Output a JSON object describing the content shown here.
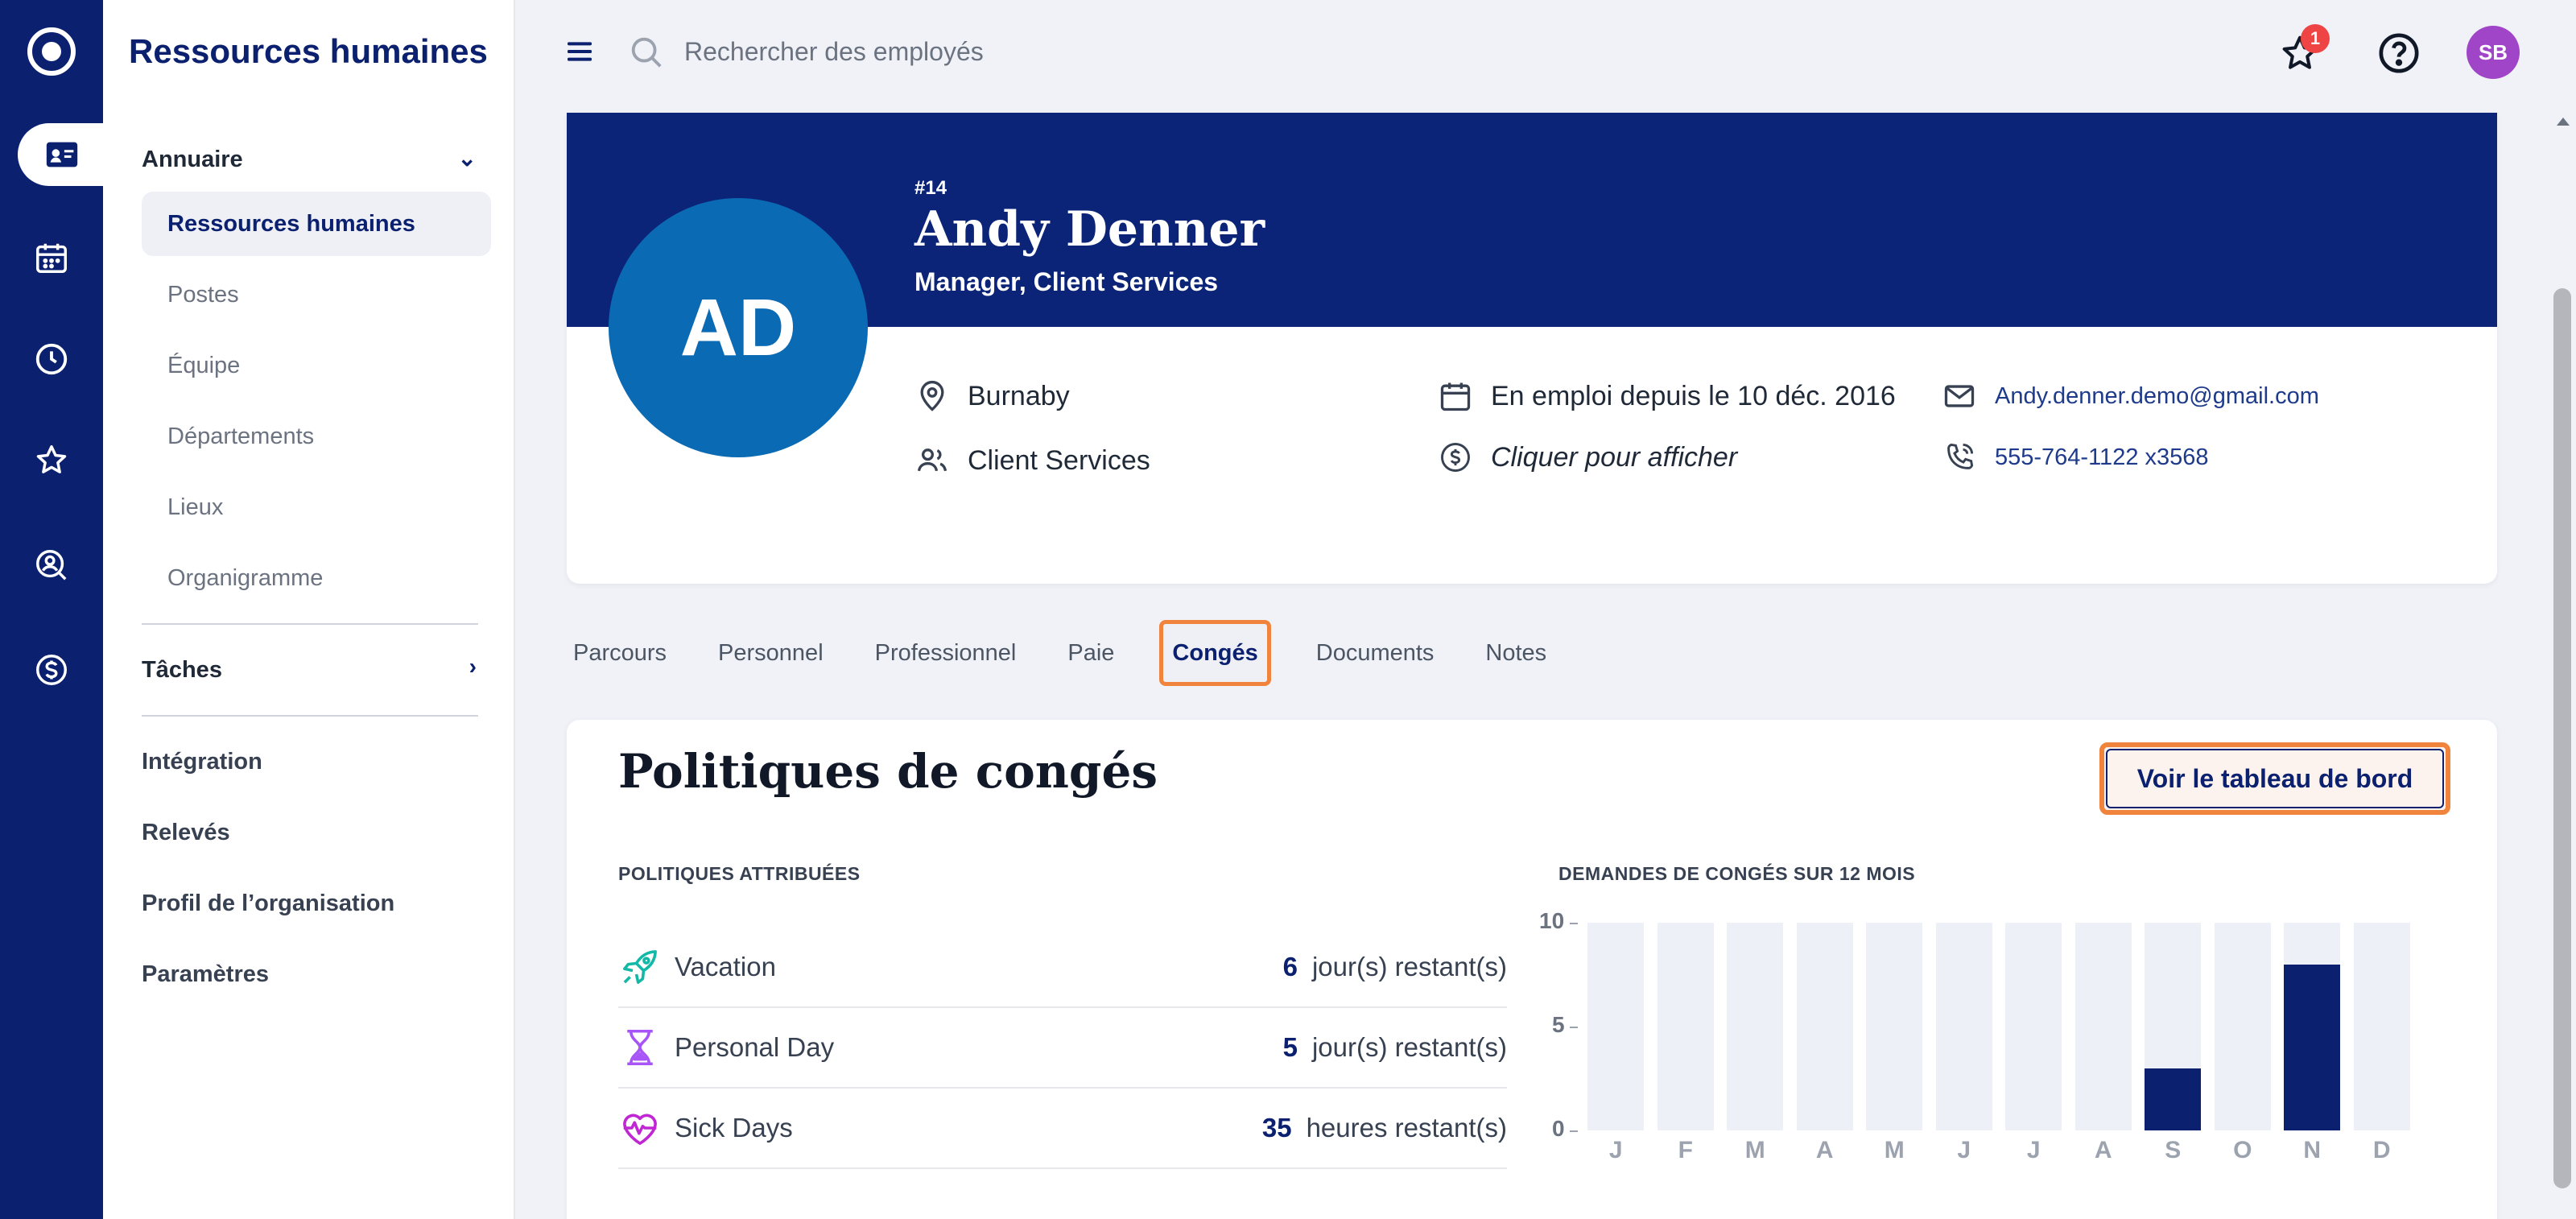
{
  "app": {
    "title": "Ressources humaines"
  },
  "search": {
    "placeholder": "Rechercher des employés"
  },
  "topbar": {
    "notification_count": "1",
    "user_initials": "SB"
  },
  "sidebar": {
    "groups": {
      "annuaire": "Annuaire",
      "taches": "Tâches"
    },
    "directory_items": [
      {
        "label": "Ressources humaines",
        "active": true
      },
      {
        "label": "Postes",
        "active": false
      },
      {
        "label": "Équipe",
        "active": false
      },
      {
        "label": "Départements",
        "active": false
      },
      {
        "label": "Lieux",
        "active": false
      },
      {
        "label": "Organigramme",
        "active": false
      }
    ],
    "links": [
      "Intégration",
      "Relevés",
      "Profil de l’organisation",
      "Paramètres"
    ]
  },
  "rail": {
    "icons": [
      "logo-icon",
      "directory-icon",
      "calendar-icon",
      "clock-icon",
      "star-icon",
      "search-person-icon",
      "dollar-icon"
    ]
  },
  "profile": {
    "number": "#14",
    "name": "Andy Denner",
    "title": "Manager, Client Services",
    "initials": "AD",
    "location": "Burnaby",
    "department": "Client Services",
    "employment": "En emploi depuis le 10 déc. 2016",
    "salary_prompt": "Cliquer pour afficher",
    "email": "Andy.denner.demo@gmail.com",
    "phone": "555-764-1122 x3568"
  },
  "tabs": [
    {
      "label": "Parcours",
      "active": false
    },
    {
      "label": "Personnel",
      "active": false
    },
    {
      "label": "Professionnel",
      "active": false
    },
    {
      "label": "Paie",
      "active": false
    },
    {
      "label": "Congés",
      "active": true
    },
    {
      "label": "Documents",
      "active": false
    },
    {
      "label": "Notes",
      "active": false
    }
  ],
  "leave": {
    "title": "Politiques de congés",
    "dashboard_button": "Voir le tableau de bord",
    "assigned_label": "POLITIQUES ATTRIBUÉES",
    "requests_label": "DEMANDES DE CONGÉS SUR 12 MOIS",
    "policies": [
      {
        "name": "Vacation",
        "value": "6",
        "unit": "jour(s) restant(s)",
        "icon": "rocket-icon",
        "color": "#14b8a6"
      },
      {
        "name": "Personal Day",
        "value": "5",
        "unit": "jour(s) restant(s)",
        "icon": "hourglass-icon",
        "color": "#a855f7"
      },
      {
        "name": "Sick Days",
        "value": "35",
        "unit": "heures restant(s)",
        "icon": "heart-pulse-icon",
        "color": "#c026d3"
      }
    ]
  },
  "colors": {
    "brand": "#0b2170",
    "banner": "#0b2478",
    "avatar": "#0a6ab3",
    "highlight": "#f0843c",
    "bar": "#0b2170",
    "bar_bg": "#eef0f8"
  },
  "chart_data": {
    "type": "bar",
    "categories": [
      "J",
      "F",
      "M",
      "A",
      "M",
      "J",
      "J",
      "A",
      "S",
      "O",
      "N",
      "D"
    ],
    "values": [
      0,
      0,
      0,
      0,
      0,
      0,
      0,
      0,
      3,
      0,
      8,
      0
    ],
    "ylim": [
      0,
      10
    ],
    "yticks": [
      "0",
      "5",
      "10"
    ],
    "ytick_values": [
      0,
      5,
      10
    ],
    "title": "",
    "xlabel": "",
    "ylabel": ""
  }
}
